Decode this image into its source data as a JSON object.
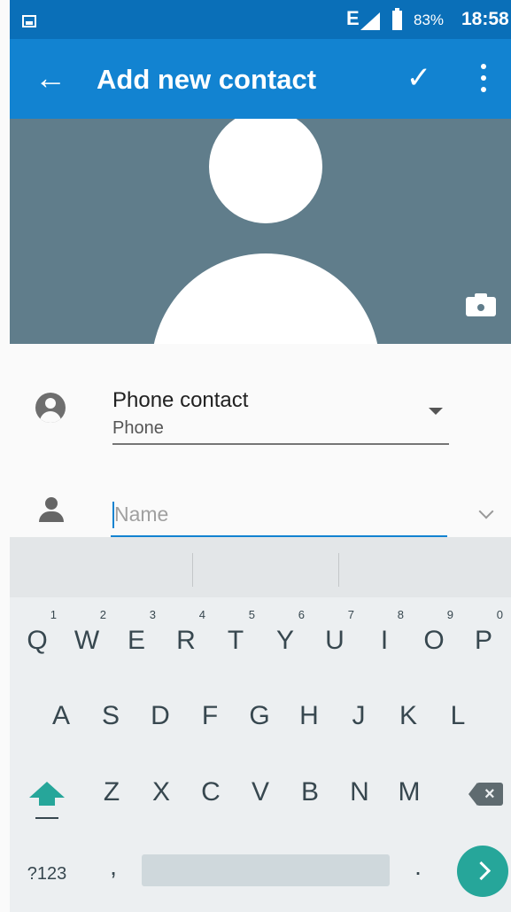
{
  "status_bar": {
    "icons": [
      "image-notification-icon",
      "signal-icon",
      "battery-icon"
    ],
    "network_type": "E",
    "battery_percent": "83%",
    "time": "18:58"
  },
  "app_bar": {
    "back_icon": "arrow-left-icon",
    "title": "Add new contact",
    "save_icon": "checkmark-icon",
    "more_icon": "more-vert-icon",
    "background": "#1283d1"
  },
  "photo": {
    "background": "#607d8b",
    "camera_icon": "camera-icon"
  },
  "form": {
    "account": {
      "icon": "account-circle-icon",
      "title": "Phone contact",
      "subtitle": "Phone"
    },
    "name": {
      "icon": "person-icon",
      "placeholder": "Name",
      "value": "",
      "expand_icon": "chevron-down-icon"
    }
  },
  "keyboard": {
    "row1": [
      {
        "label": "Q",
        "hint": "1"
      },
      {
        "label": "W",
        "hint": "2"
      },
      {
        "label": "E",
        "hint": "3"
      },
      {
        "label": "R",
        "hint": "4"
      },
      {
        "label": "T",
        "hint": "5"
      },
      {
        "label": "Y",
        "hint": "6"
      },
      {
        "label": "U",
        "hint": "7"
      },
      {
        "label": "I",
        "hint": "8"
      },
      {
        "label": "O",
        "hint": "9"
      },
      {
        "label": "P",
        "hint": "0"
      }
    ],
    "row2": [
      "A",
      "S",
      "D",
      "F",
      "G",
      "H",
      "J",
      "K",
      "L"
    ],
    "row3": [
      "Z",
      "X",
      "C",
      "V",
      "B",
      "N",
      "M"
    ],
    "symbols_label": "?123",
    "comma": ",",
    "period": ".",
    "accent": "#26a69a"
  }
}
